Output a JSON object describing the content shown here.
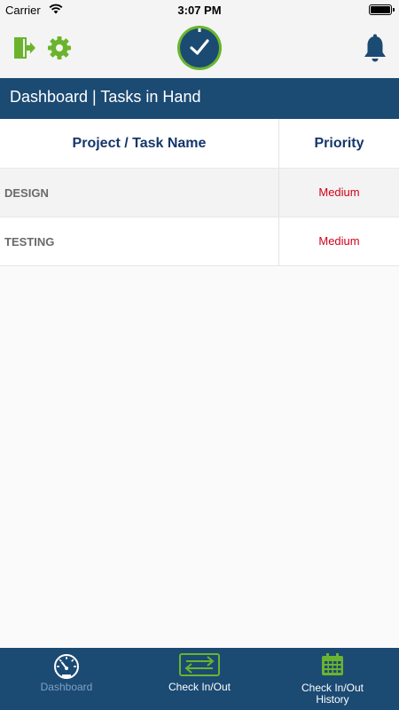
{
  "status_bar": {
    "carrier": "Carrier",
    "time": "3:07 PM",
    "battery_level": 1.0
  },
  "header": {
    "icons": [
      "logout-icon",
      "gear-icon",
      "clock-check-logo",
      "bell-icon"
    ],
    "accent_color": "#6ab42d",
    "bell_color": "#1b4a73"
  },
  "title_bar": {
    "title": "Dashboard | Tasks in Hand",
    "background": "#1b4a73"
  },
  "table": {
    "headers": {
      "name": "Project / Task Name",
      "priority": "Priority"
    },
    "rows": [
      {
        "name": "DESIGN",
        "priority": "Medium"
      },
      {
        "name": "TESTING",
        "priority": "Medium"
      }
    ],
    "priority_color": "#d0021b"
  },
  "tab_bar": {
    "tabs": [
      {
        "label": "Dashboard",
        "icon": "speedometer-icon",
        "active": true
      },
      {
        "label": "Check In/Out",
        "icon": "swap-arrows-icon",
        "active": false
      },
      {
        "label_line1": "Check In/Out",
        "label_line2": "History",
        "icon": "calendar-icon",
        "active": false
      }
    ]
  }
}
